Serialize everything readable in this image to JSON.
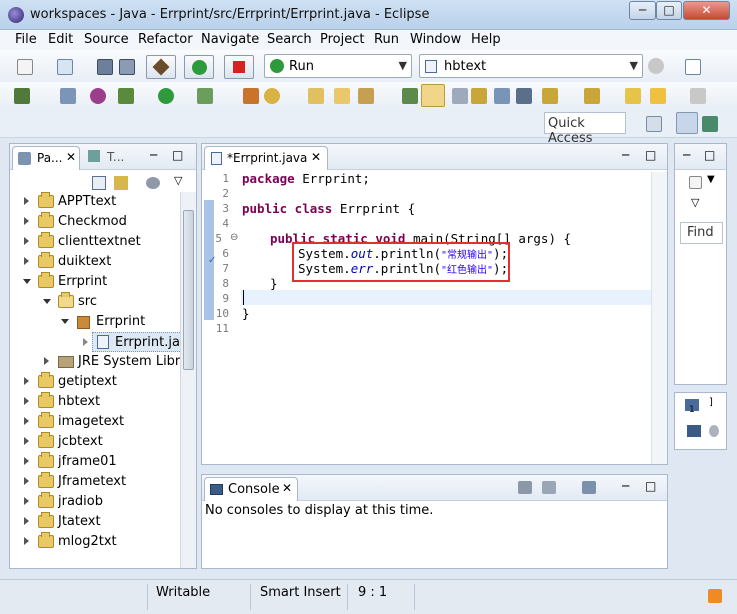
{
  "window": {
    "title": "workspaces - Java - Errprint/src/Errprint/Errprint.java - Eclipse",
    "min_label": "─",
    "max_label": "□",
    "close_label": "✕"
  },
  "menu": [
    "File",
    "Edit",
    "Source",
    "Refactor",
    "Navigate",
    "Search",
    "Project",
    "Run",
    "Window",
    "Help"
  ],
  "toolbar": {
    "run_combo": "Run",
    "project_combo": "hbtext",
    "quick_access": "Quick Access"
  },
  "package_explorer": {
    "tab_label": "Pa...",
    "tab2_label": "T...",
    "items": [
      {
        "label": "APPTtext"
      },
      {
        "label": "Checkmod"
      },
      {
        "label": "clienttextnet"
      },
      {
        "label": "duiktext"
      },
      {
        "label": "Errprint"
      },
      {
        "label": "src"
      },
      {
        "label": "Errprint"
      },
      {
        "label": "Errprint.java"
      },
      {
        "label": "JRE System Library"
      },
      {
        "label": "getiptext"
      },
      {
        "label": "hbtext"
      },
      {
        "label": "imagetext"
      },
      {
        "label": "jcbtext"
      },
      {
        "label": "jframe01"
      },
      {
        "label": "Jframetext"
      },
      {
        "label": "jradiob"
      },
      {
        "label": "Jtatext"
      },
      {
        "label": "mlog2txt"
      }
    ]
  },
  "editor": {
    "tab_label": "*Errprint.java",
    "line_numbers": [
      "1",
      "2",
      "3",
      "4",
      "5",
      "6",
      "7",
      "8",
      "9",
      "10",
      "11"
    ],
    "lines": {
      "l1_kw": "package",
      "l1_rest": " Errprint;",
      "l3_kw": "public class",
      "l3_rest": " Errprint {",
      "l5_kw": "public static void",
      "l5_rest": " main(String[] args) {",
      "l6_a": "System.",
      "l6_field": "out",
      "l6_b": ".println(",
      "l6_str": "\"常规输出\"",
      "l6_c": ");",
      "l7_a": "System.",
      "l7_field": "err",
      "l7_b": ".println(",
      "l7_str": "\"红色输出\"",
      "l7_c": ");",
      "l8": "}",
      "l10": "}"
    }
  },
  "console": {
    "tab_label": "Console",
    "message": "No consoles to display at this time."
  },
  "right_panel": {
    "find_label": "Find"
  },
  "statusbar": {
    "writable": "Writable",
    "insert_mode": "Smart Insert",
    "position": "9 : 1"
  },
  "colors": {
    "highlight_box": "#e03030",
    "current_line": "#e8f2fe",
    "keyword": "#7f0055"
  }
}
